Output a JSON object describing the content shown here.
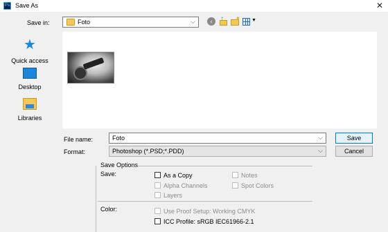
{
  "window": {
    "title": "Save As",
    "app_icon": "Ps"
  },
  "save_in": {
    "label": "Save in:",
    "value": "Foto"
  },
  "places": [
    {
      "label": "Quick access"
    },
    {
      "label": "Desktop"
    },
    {
      "label": "Libraries"
    }
  ],
  "file_name": {
    "label": "File name:",
    "value": "Foto"
  },
  "format": {
    "label": "Format:",
    "value": "Photoshop (*.PSD;*.PDD)"
  },
  "buttons": {
    "save": "Save",
    "cancel": "Cancel"
  },
  "save_options": {
    "heading": "Save Options",
    "save_label": "Save:",
    "as_a_copy": "As a Copy",
    "notes": "Notes",
    "alpha_channels": "Alpha Channels",
    "spot_colors": "Spot Colors",
    "layers": "Layers",
    "color_label": "Color:",
    "use_proof_setup": "Use Proof Setup:  Working CMYK",
    "icc_profile": "ICC Profile:  sRGB IEC61966-2.1"
  },
  "colors": {
    "accent": "#0078d7",
    "folder": "#f6c754"
  }
}
